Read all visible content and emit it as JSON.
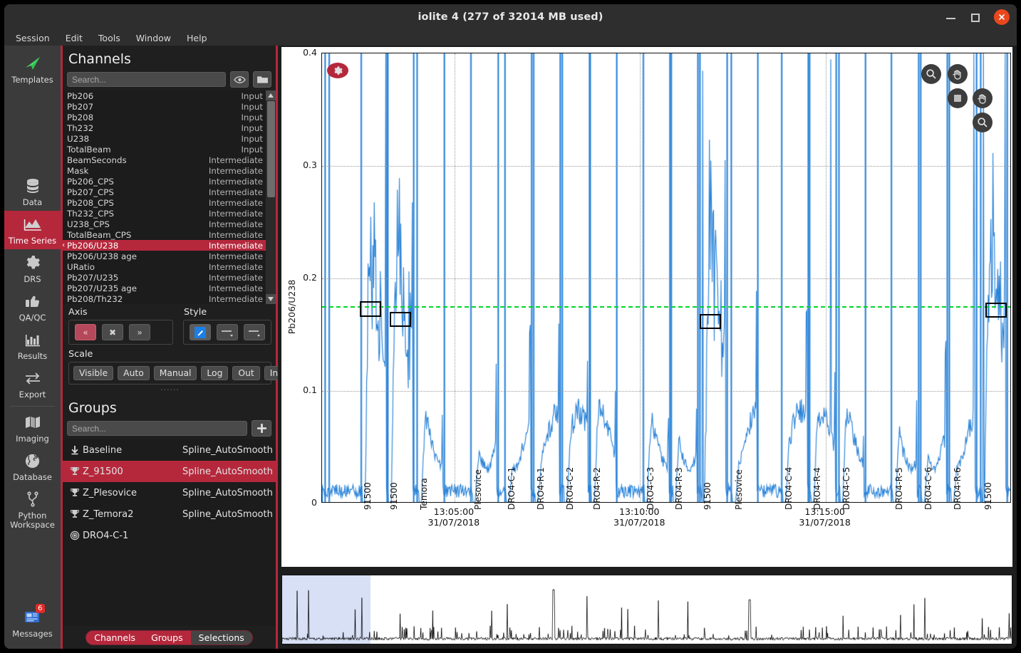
{
  "window": {
    "title": "iolite 4 (277 of 32014 MB used)",
    "minimize_label": "—",
    "maximize_label": "□",
    "close_label": "✕"
  },
  "menubar": [
    {
      "label": "Session"
    },
    {
      "label": "Edit"
    },
    {
      "label": "Tools"
    },
    {
      "label": "Window"
    },
    {
      "label": "Help"
    }
  ],
  "rail": [
    {
      "label": "Templates",
      "icon": "paper-plane-icon",
      "active": false
    },
    {
      "label": "Data",
      "icon": "database-icon",
      "active": false
    },
    {
      "label": "Time Series",
      "icon": "mountain-chart-icon",
      "active": true
    },
    {
      "label": "DRS",
      "icon": "gear-icon",
      "active": false
    },
    {
      "label": "QA/QC",
      "icon": "thumbs-up-icon",
      "active": false
    },
    {
      "label": "Results",
      "icon": "bar-chart-icon",
      "active": false
    },
    {
      "label": "Export",
      "icon": "arrows-exchange-icon",
      "active": false
    },
    {
      "label": "Imaging",
      "icon": "map-icon",
      "active": false
    },
    {
      "label": "Database",
      "icon": "globe-icon",
      "active": false
    },
    {
      "label": "Python\nWorkspace",
      "icon": "branch-icon",
      "active": false
    },
    {
      "label": "Messages",
      "icon": "messages-icon",
      "active": false,
      "badge": "6"
    }
  ],
  "channels_panel": {
    "title": "Channels",
    "search_placeholder": "Search...",
    "eye_button": "eye-icon",
    "folder_button": "folder-icon",
    "items": [
      {
        "name": "Pb206",
        "type": "Input"
      },
      {
        "name": "Pb207",
        "type": "Input"
      },
      {
        "name": "Pb208",
        "type": "Input"
      },
      {
        "name": "Th232",
        "type": "Input"
      },
      {
        "name": "U238",
        "type": "Input"
      },
      {
        "name": "TotalBeam",
        "type": "Input"
      },
      {
        "name": "BeamSeconds",
        "type": "Intermediate"
      },
      {
        "name": "Mask",
        "type": "Intermediate"
      },
      {
        "name": "Pb206_CPS",
        "type": "Intermediate"
      },
      {
        "name": "Pb207_CPS",
        "type": "Intermediate"
      },
      {
        "name": "Pb208_CPS",
        "type": "Intermediate"
      },
      {
        "name": "Th232_CPS",
        "type": "Intermediate"
      },
      {
        "name": "U238_CPS",
        "type": "Intermediate"
      },
      {
        "name": "TotalBeam_CPS",
        "type": "Intermediate"
      },
      {
        "name": "Pb206/U238",
        "type": "Intermediate",
        "selected": true
      },
      {
        "name": "Pb206/U238 age",
        "type": "Intermediate"
      },
      {
        "name": "URatio",
        "type": "Intermediate"
      },
      {
        "name": "Pb207/U235",
        "type": "Intermediate"
      },
      {
        "name": "Pb207/U235 age",
        "type": "Intermediate"
      },
      {
        "name": "Pb208/Th232",
        "type": "Intermediate"
      }
    ]
  },
  "axis_controls": {
    "axis_label": "Axis",
    "style_label": "Style",
    "scale_label": "Scale",
    "axis_buttons": [
      {
        "label": "«",
        "name": "axis-left-button",
        "active": true
      },
      {
        "label": "✖",
        "name": "axis-clear-button",
        "active": false
      },
      {
        "label": "»",
        "name": "axis-right-button",
        "active": false
      }
    ],
    "style_buttons": [
      {
        "label": "",
        "name": "style-color-button"
      },
      {
        "label": "",
        "name": "style-line-button"
      },
      {
        "label": "",
        "name": "style-marker-button"
      }
    ],
    "scale_buttons": [
      "Visible",
      "Auto",
      "Manual",
      "Log",
      "Out",
      "In"
    ]
  },
  "groups_panel": {
    "title": "Groups",
    "search_placeholder": "Search...",
    "add_label": "+",
    "items": [
      {
        "name": "Baseline",
        "method": "Spline_AutoSmooth",
        "icon": "down-arrow-icon",
        "selected": false
      },
      {
        "name": "Z_91500",
        "method": "Spline_AutoSmooth",
        "icon": "trophy-icon",
        "selected": true
      },
      {
        "name": "Z_Plesovice",
        "method": "Spline_AutoSmooth",
        "icon": "trophy-icon",
        "selected": false
      },
      {
        "name": "Z_Temora2",
        "method": "Spline_AutoSmooth",
        "icon": "trophy-icon",
        "selected": false
      },
      {
        "name": "DRO4-C-1",
        "method": "",
        "icon": "target-icon",
        "selected": false
      }
    ]
  },
  "bottom_tabs": [
    {
      "label": "Channels",
      "active": false
    },
    {
      "label": "Groups",
      "active": false
    },
    {
      "label": "Selections",
      "active": true
    }
  ],
  "plot_toolbar": {
    "gear_button": "gear-icon",
    "buttons": [
      {
        "name": "zoom-x-button",
        "icon": "magnifier-icon"
      },
      {
        "name": "pan-x-button",
        "icon": "hand-icon"
      },
      {
        "name": "reset-button",
        "icon": "square-icon"
      },
      {
        "name": "pan-y-button",
        "icon": "hand-icon"
      },
      {
        "name": "zoom-y-button",
        "icon": "magnifier-icon"
      }
    ]
  },
  "chart_data": {
    "type": "line",
    "title": "",
    "xlabel": "",
    "ylabel": "Pb206/U238",
    "ylim": [
      0,
      0.4
    ],
    "yticks": [
      "0",
      "0.1",
      "0.2",
      "0.3",
      "0.4"
    ],
    "ytick_values": [
      0,
      0.1,
      0.2,
      0.3,
      0.4
    ],
    "grid": true,
    "legend": "none",
    "series_color": "#2a83d8",
    "time_ticks": [
      {
        "time": "13:05:00",
        "date": "31/07/2018",
        "x_frac": 0.192
      },
      {
        "time": "13:10:00",
        "date": "31/07/2018",
        "x_frac": 0.461
      },
      {
        "time": "13:15:00",
        "date": "31/07/2018",
        "x_frac": 0.73
      }
    ],
    "reference_line": {
      "value": 0.1755,
      "color": "#00d42a",
      "style": "dashed"
    },
    "selection_boxes": [
      {
        "label": "91500",
        "x_frac": 0.055,
        "y_value": 0.1795,
        "height_value": 0.0135
      },
      {
        "label": "91500",
        "x_frac": 0.098,
        "y_value": 0.1705,
        "height_value": 0.0135
      },
      {
        "label": "91500",
        "x_frac": 0.548,
        "y_value": 0.1685,
        "height_value": 0.0135
      },
      {
        "label": "91500",
        "x_frac": 0.962,
        "y_value": 0.1785,
        "height_value": 0.0135
      }
    ],
    "sample_labels": [
      {
        "label": "91500",
        "x_frac": 0.062
      },
      {
        "label": "91500",
        "x_frac": 0.1
      },
      {
        "label": "Temora",
        "x_frac": 0.144
      },
      {
        "label": "Plesovice",
        "x_frac": 0.222
      },
      {
        "label": "DRO4-C-1",
        "x_frac": 0.271
      },
      {
        "label": "DRO4-R-1",
        "x_frac": 0.313
      },
      {
        "label": "DRO4-C-2",
        "x_frac": 0.355
      },
      {
        "label": "DRO4-R-2",
        "x_frac": 0.395
      },
      {
        "label": "DRO4-C-3",
        "x_frac": 0.472
      },
      {
        "label": "DRO4-R-3",
        "x_frac": 0.513
      },
      {
        "label": "91500",
        "x_frac": 0.555
      },
      {
        "label": "Plesovice",
        "x_frac": 0.6
      },
      {
        "label": "DRO4-C-4",
        "x_frac": 0.673
      },
      {
        "label": "DRO4-R-4",
        "x_frac": 0.714
      },
      {
        "label": "DRO4-C-5",
        "x_frac": 0.756
      },
      {
        "label": "DRO4-R-5",
        "x_frac": 0.833
      },
      {
        "label": "DRO4-C-6",
        "x_frac": 0.875
      },
      {
        "label": "DRO4-R-6",
        "x_frac": 0.917
      },
      {
        "label": "91500",
        "x_frac": 0.962
      }
    ]
  },
  "overview_chart": {
    "type": "line",
    "selection_start_frac": 0.0,
    "selection_end_frac": 0.121,
    "selection_color": "#d8e0f6",
    "trace_color": "#000000"
  }
}
